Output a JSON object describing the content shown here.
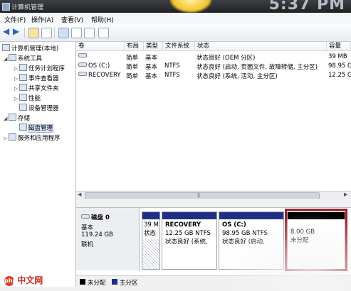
{
  "window": {
    "title": "计算机管理",
    "clock": "5:37 PM"
  },
  "menu": [
    "文件(F)",
    "操作(A)",
    "查看(V)",
    "帮助(H)"
  ],
  "tree": {
    "root": "计算机管理(本地)",
    "system_tools": "系统工具",
    "task_scheduler": "任务计划程序",
    "event_viewer": "事件查看器",
    "shared_folders": "共享文件夹",
    "performance": "性能",
    "device_manager": "设备管理器",
    "storage": "存储",
    "disk_management": "磁盘管理",
    "services": "服务和应用程序"
  },
  "columns": [
    "卷",
    "布局",
    "类型",
    "文件系统",
    "状态",
    "容量"
  ],
  "volumes": [
    {
      "name": "",
      "layout": "简单",
      "type": "基本",
      "fs": "",
      "status": "状态良好 (OEM 分区)",
      "capacity": "39 MB"
    },
    {
      "name": "OS (C:)",
      "layout": "简单",
      "type": "基本",
      "fs": "NTFS",
      "status": "状态良好 (启动, 页面文件, 故障转储, 主分区)",
      "capacity": "98.95 G"
    },
    {
      "name": "RECOVERY",
      "layout": "简单",
      "type": "基本",
      "fs": "NTFS",
      "status": "状态良好 (系统, 活动, 主分区)",
      "capacity": "12.25 G"
    }
  ],
  "disk": {
    "label": "磁盘 0",
    "type": "基本",
    "size": "119.24 GB",
    "state": "联机"
  },
  "partitions": [
    {
      "line1": "39 M",
      "line2": "状态"
    },
    {
      "name": "RECOVERY",
      "size": "12.25 GB NTFS",
      "status": "状态良好 (系统,"
    },
    {
      "name": "OS  (C:)",
      "size": "98.95 GB NTFS",
      "status": "状态良好 (启动,"
    },
    {
      "size": "8.00 GB",
      "status": "未分配"
    }
  ],
  "legend": {
    "unallocated": "未分配",
    "primary": "主分区"
  },
  "watermark": "中文网",
  "watermark_logo": "php",
  "colors": {
    "primary_band": "#1f2f85",
    "unallocated_band": "#000000",
    "highlight": "#a12028"
  }
}
